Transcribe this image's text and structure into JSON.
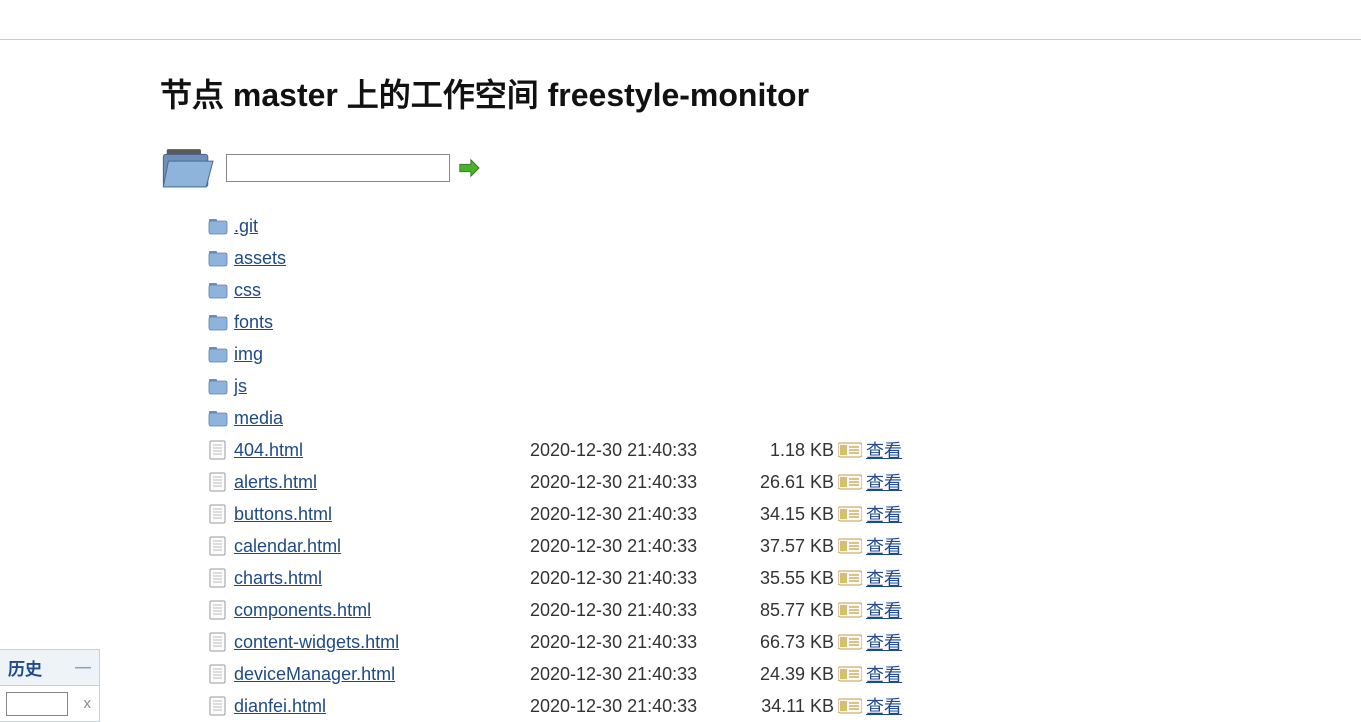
{
  "page_title": "节点 master 上的工作空间 freestyle-monitor",
  "path_input": {
    "value": "",
    "placeholder": ""
  },
  "view_label": "查看",
  "folders": [
    {
      "name": ".git"
    },
    {
      "name": "assets"
    },
    {
      "name": "css"
    },
    {
      "name": "fonts"
    },
    {
      "name": "img"
    },
    {
      "name": "js"
    },
    {
      "name": "media"
    }
  ],
  "files": [
    {
      "name": "404.html",
      "date": "2020-12-30 21:40:33",
      "size": "1.18 KB"
    },
    {
      "name": "alerts.html",
      "date": "2020-12-30 21:40:33",
      "size": "26.61 KB"
    },
    {
      "name": "buttons.html",
      "date": "2020-12-30 21:40:33",
      "size": "34.15 KB"
    },
    {
      "name": "calendar.html",
      "date": "2020-12-30 21:40:33",
      "size": "37.57 KB"
    },
    {
      "name": "charts.html",
      "date": "2020-12-30 21:40:33",
      "size": "35.55 KB"
    },
    {
      "name": "components.html",
      "date": "2020-12-30 21:40:33",
      "size": "85.77 KB"
    },
    {
      "name": "content-widgets.html",
      "date": "2020-12-30 21:40:33",
      "size": "66.73 KB"
    },
    {
      "name": "deviceManager.html",
      "date": "2020-12-30 21:40:33",
      "size": "24.39 KB"
    },
    {
      "name": "dianfei.html",
      "date": "2020-12-30 21:40:33",
      "size": "34.11 KB"
    }
  ],
  "sidebar": {
    "history_label": "历史",
    "search_value": ""
  }
}
